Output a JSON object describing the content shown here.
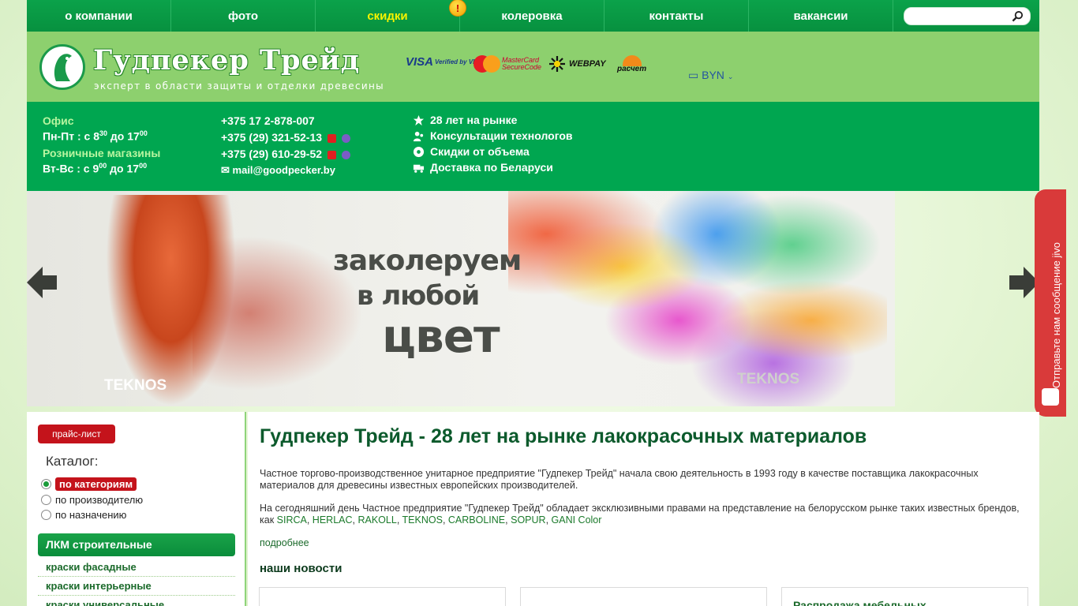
{
  "nav": {
    "items": [
      {
        "label": "о компании"
      },
      {
        "label": "фото"
      },
      {
        "label": "скидки",
        "highlight": true
      },
      {
        "label": "колеровка"
      },
      {
        "label": "контакты"
      },
      {
        "label": "вакансии"
      }
    ],
    "badge": "!",
    "search_placeholder": ""
  },
  "header": {
    "logo_title": "Гудпекер Трейд",
    "logo_subtitle": "эксперт в области защиты и отделки древесины",
    "payments": {
      "visa": "VISA",
      "visa_verified": "Verified by VISA",
      "mastercard": "MasterCard SecureCode",
      "webpay": "WEBPAY",
      "raschet": "расчет"
    },
    "currency": "BYN"
  },
  "info": {
    "office_label": "Офис",
    "office_hours": {
      "prefix": "Пн-Пт : с 8",
      "sup1": "30",
      "mid": " до 17",
      "sup2": "00"
    },
    "shops_label": "Розничные магазины",
    "shops_hours": {
      "prefix": "Вт-Вс : с 9",
      "sup1": "00",
      "mid": " до 17",
      "sup2": "00"
    },
    "phones": [
      "+375 17 2-878-007",
      "+375 (29) 321-52-13",
      "+375 (29) 610-29-52"
    ],
    "email": "mail@goodpecker.by",
    "features": [
      "28 лет на рынке",
      "Консультации технологов",
      "Скидки от объема",
      "Доставка по Беларуси"
    ]
  },
  "banner": {
    "line1": "заколеруем",
    "line2": "в любой",
    "line3": "цвет",
    "brand": "TEKNOS",
    "brand2": "TEKNOS"
  },
  "jivo": {
    "label": "Отправьте нам сообщение  jivo"
  },
  "sidebar": {
    "price_button": "прайс-лист",
    "catalog_heading": "Каталог:",
    "radios": [
      {
        "label": "по категориям",
        "selected": true
      },
      {
        "label": "по производителю",
        "selected": false
      },
      {
        "label": "по назначению",
        "selected": false
      }
    ],
    "category_title": "ЛКМ строительные",
    "links": [
      "краски фасадные",
      "краски интерьерные",
      "краски универсальные"
    ]
  },
  "main": {
    "title": "Гудпекер Трейд - 28 лет на рынке лакокрасочных материалов",
    "para1": "Частное торгово-производственное унитарное предприятие \"Гудпекер Трейд\" начала свою деятельность в 1993 году в качестве поставщика лакокрасочных материалов для древесины известных европейских производителей.",
    "para2_text": "На сегодняшний день Частное предприятие \"Гудпекер Трейд\" обладает эксклюзивными правами на представление на белорусском рынке таких известных брендов, как ",
    "brands": [
      "SIRCA",
      "HERLAC",
      "RAKOLL",
      "TEKNOS",
      "CARBOLINE",
      "SOPUR",
      "GANI Color"
    ],
    "more": "подробнее",
    "news_heading": "наши новости",
    "news_card_title": "Распродажа мебельных"
  },
  "colors": {
    "green": "#00a650",
    "light_green": "#8dd06e",
    "red": "#c4131b",
    "yellow": "#f7f300"
  }
}
